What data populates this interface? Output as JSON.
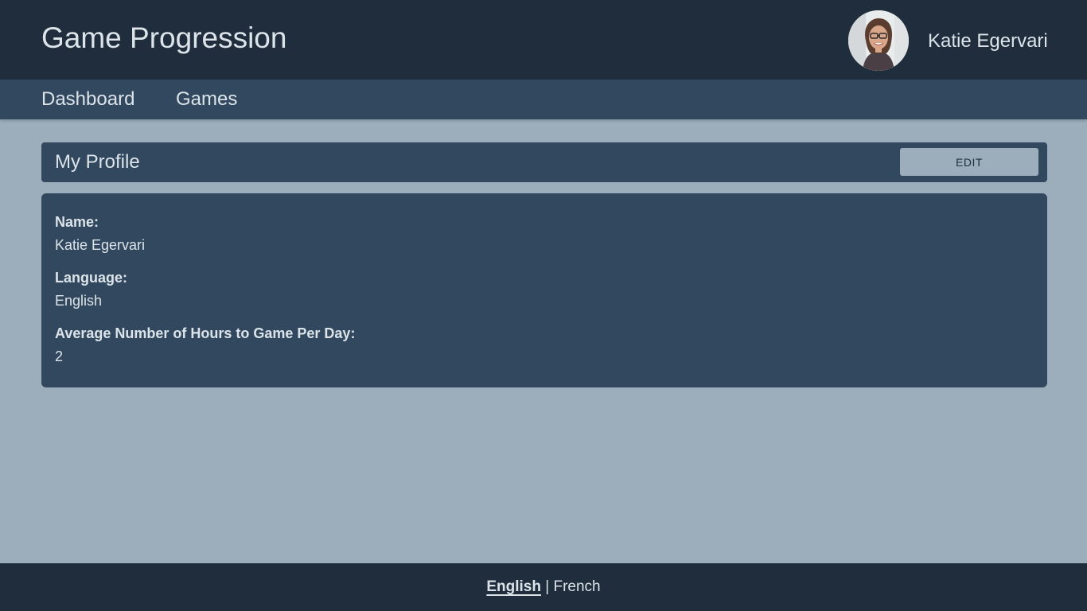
{
  "header": {
    "app_title": "Game Progression",
    "user_name": "Katie Egervari"
  },
  "nav": {
    "items": [
      {
        "label": "Dashboard"
      },
      {
        "label": "Games"
      }
    ]
  },
  "profile": {
    "title": "My Profile",
    "edit_label": "EDIT",
    "fields": [
      {
        "label": "Name:",
        "value": "Katie Egervari"
      },
      {
        "label": "Language:",
        "value": "English"
      },
      {
        "label": "Average Number of Hours to Game Per Day:",
        "value": "2"
      }
    ]
  },
  "footer": {
    "languages": [
      {
        "label": "English",
        "selected": true
      },
      {
        "label": "French",
        "selected": false
      }
    ],
    "separator": "|"
  },
  "colors": {
    "header_bg": "#1f2d3c",
    "nav_bg": "#32485e",
    "page_bg": "#9caebb",
    "text": "#dce4ea"
  }
}
